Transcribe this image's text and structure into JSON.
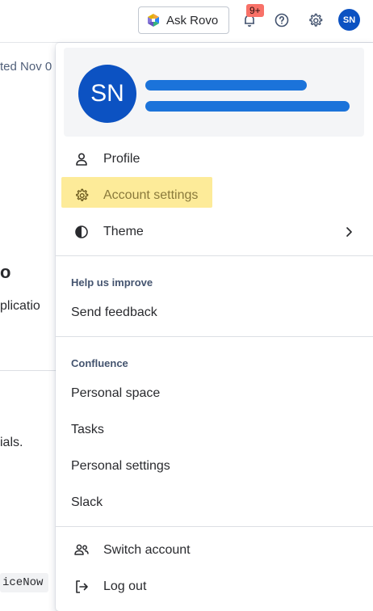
{
  "topbar": {
    "ask_rovo_label": "Ask Rovo",
    "notifications_badge": "9+",
    "avatar_initials": "SN"
  },
  "background": {
    "fragment_1": "ted Nov 0",
    "fragment_2": "o",
    "fragment_3": "plicatio",
    "fragment_4": "ials.",
    "fragment_5": "iceNow"
  },
  "profile": {
    "initials": "SN"
  },
  "menu": {
    "profile_label": "Profile",
    "account_settings_label": "Account settings",
    "theme_label": "Theme",
    "help_header": "Help us improve",
    "send_feedback_label": "Send feedback",
    "confluence_header": "Confluence",
    "personal_space_label": "Personal space",
    "tasks_label": "Tasks",
    "personal_settings_label": "Personal settings",
    "slack_label": "Slack",
    "switch_account_label": "Switch account",
    "log_out_label": "Log out"
  },
  "colors": {
    "avatar": "#0c52c2",
    "highlight": "#fdeb99",
    "badge": "#f87168"
  }
}
